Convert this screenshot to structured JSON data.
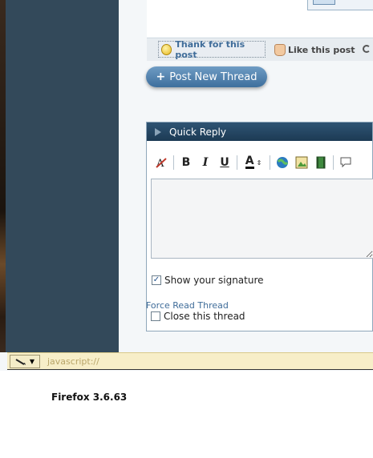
{
  "post": {
    "thank_label": "Thank for this post",
    "like_label": "Like this post"
  },
  "actions": {
    "post_new_thread_label": "Post New Thread",
    "post_new_thread_plus": "+"
  },
  "quick_reply": {
    "title": "Quick Reply",
    "toolbar": [
      {
        "icon": "remove-format-icon"
      },
      {
        "icon": "bold-icon",
        "glyph": "B"
      },
      {
        "icon": "italic-icon",
        "glyph": "I"
      },
      {
        "icon": "underline-icon",
        "glyph": "U"
      },
      {
        "icon": "font-color-icon",
        "glyph": "A"
      },
      {
        "icon": "insert-link-icon"
      },
      {
        "icon": "insert-image-icon"
      },
      {
        "icon": "insert-video-icon"
      },
      {
        "icon": "quote-icon"
      }
    ],
    "editor_value": "",
    "show_signature_label": "Show your signature",
    "show_signature_checked": true,
    "force_read_label": "Force Read Thread",
    "close_thread_label": "Close this thread",
    "close_thread_checked": false
  },
  "statusbar": {
    "text": "javascript://"
  },
  "caption": "Firefox 3.6.63",
  "colors": {
    "sidebar": "#33495a",
    "header": "#1c3a54",
    "accent": "#3f6c99",
    "statusbar": "#f7eec8"
  }
}
